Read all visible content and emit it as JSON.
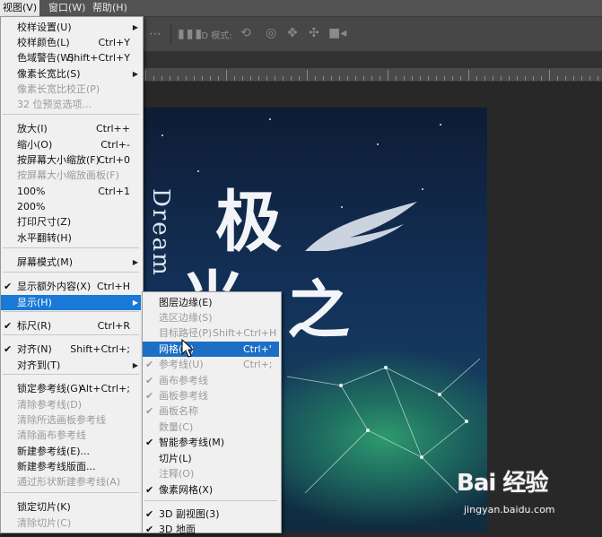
{
  "menubar": {
    "items": [
      {
        "label": "视图(V)",
        "active": true
      },
      {
        "label": "窗口(W)",
        "active": false
      },
      {
        "label": "帮助(H)",
        "active": false
      }
    ]
  },
  "options_bar": {
    "mode_label": "3D 模式:"
  },
  "view_menu": {
    "items": [
      {
        "label": "校样设置(U)",
        "shortcut": "",
        "submenu": true,
        "disabled": false,
        "checked": false
      },
      {
        "label": "校样颜色(L)",
        "shortcut": "Ctrl+Y",
        "submenu": false,
        "disabled": false,
        "checked": false
      },
      {
        "label": "色域警告(W)",
        "shortcut": "Shift+Ctrl+Y",
        "submenu": false,
        "disabled": false,
        "checked": false
      },
      {
        "label": "像素长宽比(S)",
        "shortcut": "",
        "submenu": true,
        "disabled": false,
        "checked": false
      },
      {
        "label": "像素长宽比校正(P)",
        "shortcut": "",
        "submenu": false,
        "disabled": true,
        "checked": false
      },
      {
        "label": "32 位预览选项...",
        "shortcut": "",
        "submenu": false,
        "disabled": true,
        "checked": false
      },
      {
        "label": "放大(I)",
        "shortcut": "Ctrl++",
        "submenu": false,
        "disabled": false,
        "checked": false
      },
      {
        "label": "缩小(O)",
        "shortcut": "Ctrl+-",
        "submenu": false,
        "disabled": false,
        "checked": false
      },
      {
        "label": "按屏幕大小缩放(F)",
        "shortcut": "Ctrl+0",
        "submenu": false,
        "disabled": false,
        "checked": false
      },
      {
        "label": "按屏幕大小缩放画板(F)",
        "shortcut": "",
        "submenu": false,
        "disabled": true,
        "checked": false
      },
      {
        "label": "100%",
        "shortcut": "Ctrl+1",
        "submenu": false,
        "disabled": false,
        "checked": false
      },
      {
        "label": "200%",
        "shortcut": "",
        "submenu": false,
        "disabled": false,
        "checked": false
      },
      {
        "label": "打印尺寸(Z)",
        "shortcut": "",
        "submenu": false,
        "disabled": false,
        "checked": false
      },
      {
        "label": "水平翻转(H)",
        "shortcut": "",
        "submenu": false,
        "disabled": false,
        "checked": false
      },
      {
        "label": "屏幕模式(M)",
        "shortcut": "",
        "submenu": true,
        "disabled": false,
        "checked": false
      },
      {
        "label": "显示额外内容(X)",
        "shortcut": "Ctrl+H",
        "submenu": false,
        "disabled": false,
        "checked": true
      },
      {
        "label": "显示(H)",
        "shortcut": "",
        "submenu": true,
        "disabled": false,
        "checked": false,
        "highlighted": true
      },
      {
        "label": "标尺(R)",
        "shortcut": "Ctrl+R",
        "submenu": false,
        "disabled": false,
        "checked": true
      },
      {
        "label": "对齐(N)",
        "shortcut": "Shift+Ctrl+;",
        "submenu": false,
        "disabled": false,
        "checked": true
      },
      {
        "label": "对齐到(T)",
        "shortcut": "",
        "submenu": true,
        "disabled": false,
        "checked": false
      },
      {
        "label": "锁定参考线(G)",
        "shortcut": "Alt+Ctrl+;",
        "submenu": false,
        "disabled": false,
        "checked": false
      },
      {
        "label": "清除参考线(D)",
        "shortcut": "",
        "submenu": false,
        "disabled": true,
        "checked": false
      },
      {
        "label": "清除所选画板参考线",
        "shortcut": "",
        "submenu": false,
        "disabled": true,
        "checked": false
      },
      {
        "label": "清除画布参考线",
        "shortcut": "",
        "submenu": false,
        "disabled": true,
        "checked": false
      },
      {
        "label": "新建参考线(E)...",
        "shortcut": "",
        "submenu": false,
        "disabled": false,
        "checked": false
      },
      {
        "label": "新建参考线版面...",
        "shortcut": "",
        "submenu": false,
        "disabled": false,
        "checked": false
      },
      {
        "label": "通过形状新建参考线(A)",
        "shortcut": "",
        "submenu": false,
        "disabled": true,
        "checked": false
      },
      {
        "label": "锁定切片(K)",
        "shortcut": "",
        "submenu": false,
        "disabled": false,
        "checked": false
      },
      {
        "label": "清除切片(C)",
        "shortcut": "",
        "submenu": false,
        "disabled": true,
        "checked": false
      }
    ]
  },
  "show_submenu": {
    "items": [
      {
        "label": "图层边缘(E)",
        "shortcut": "",
        "disabled": false,
        "checked": false
      },
      {
        "label": "选区边缘(S)",
        "shortcut": "",
        "disabled": true,
        "checked": false
      },
      {
        "label": "目标路径(P)",
        "shortcut": "Shift+Ctrl+H",
        "disabled": true,
        "checked": false
      },
      {
        "label": "网格(G)",
        "shortcut": "Ctrl+'",
        "disabled": false,
        "checked": false,
        "highlighted": true
      },
      {
        "label": "参考线(U)",
        "shortcut": "Ctrl+;",
        "disabled": true,
        "checked": true
      },
      {
        "label": "画布参考线",
        "shortcut": "",
        "disabled": true,
        "checked": true
      },
      {
        "label": "画板参考线",
        "shortcut": "",
        "disabled": true,
        "checked": true
      },
      {
        "label": "画板名称",
        "shortcut": "",
        "disabled": true,
        "checked": true
      },
      {
        "label": "数量(C)",
        "shortcut": "",
        "disabled": true,
        "checked": false
      },
      {
        "label": "智能参考线(M)",
        "shortcut": "",
        "disabled": false,
        "checked": true
      },
      {
        "label": "切片(L)",
        "shortcut": "",
        "disabled": false,
        "checked": false
      },
      {
        "label": "注释(O)",
        "shortcut": "",
        "disabled": true,
        "checked": false
      },
      {
        "label": "像素网格(X)",
        "shortcut": "",
        "disabled": false,
        "checked": true
      },
      {
        "label": "3D 副视图(3)",
        "shortcut": "",
        "disabled": false,
        "checked": true
      },
      {
        "label": "3D 地面",
        "shortcut": "",
        "disabled": false,
        "checked": true
      }
    ]
  },
  "canvas": {
    "vertical_text": "Dream",
    "title_char_1": "极",
    "title_char_2": "光",
    "title_char_3": "之"
  },
  "watermark": {
    "logo_text": "Bai 经验",
    "url": "jingyan.baidu.com"
  },
  "colors": {
    "menu_bg": "#f0f0f0",
    "highlight": "#1979d6",
    "disabled_text": "#9a9a9a",
    "menubar_bg": "#535353"
  }
}
